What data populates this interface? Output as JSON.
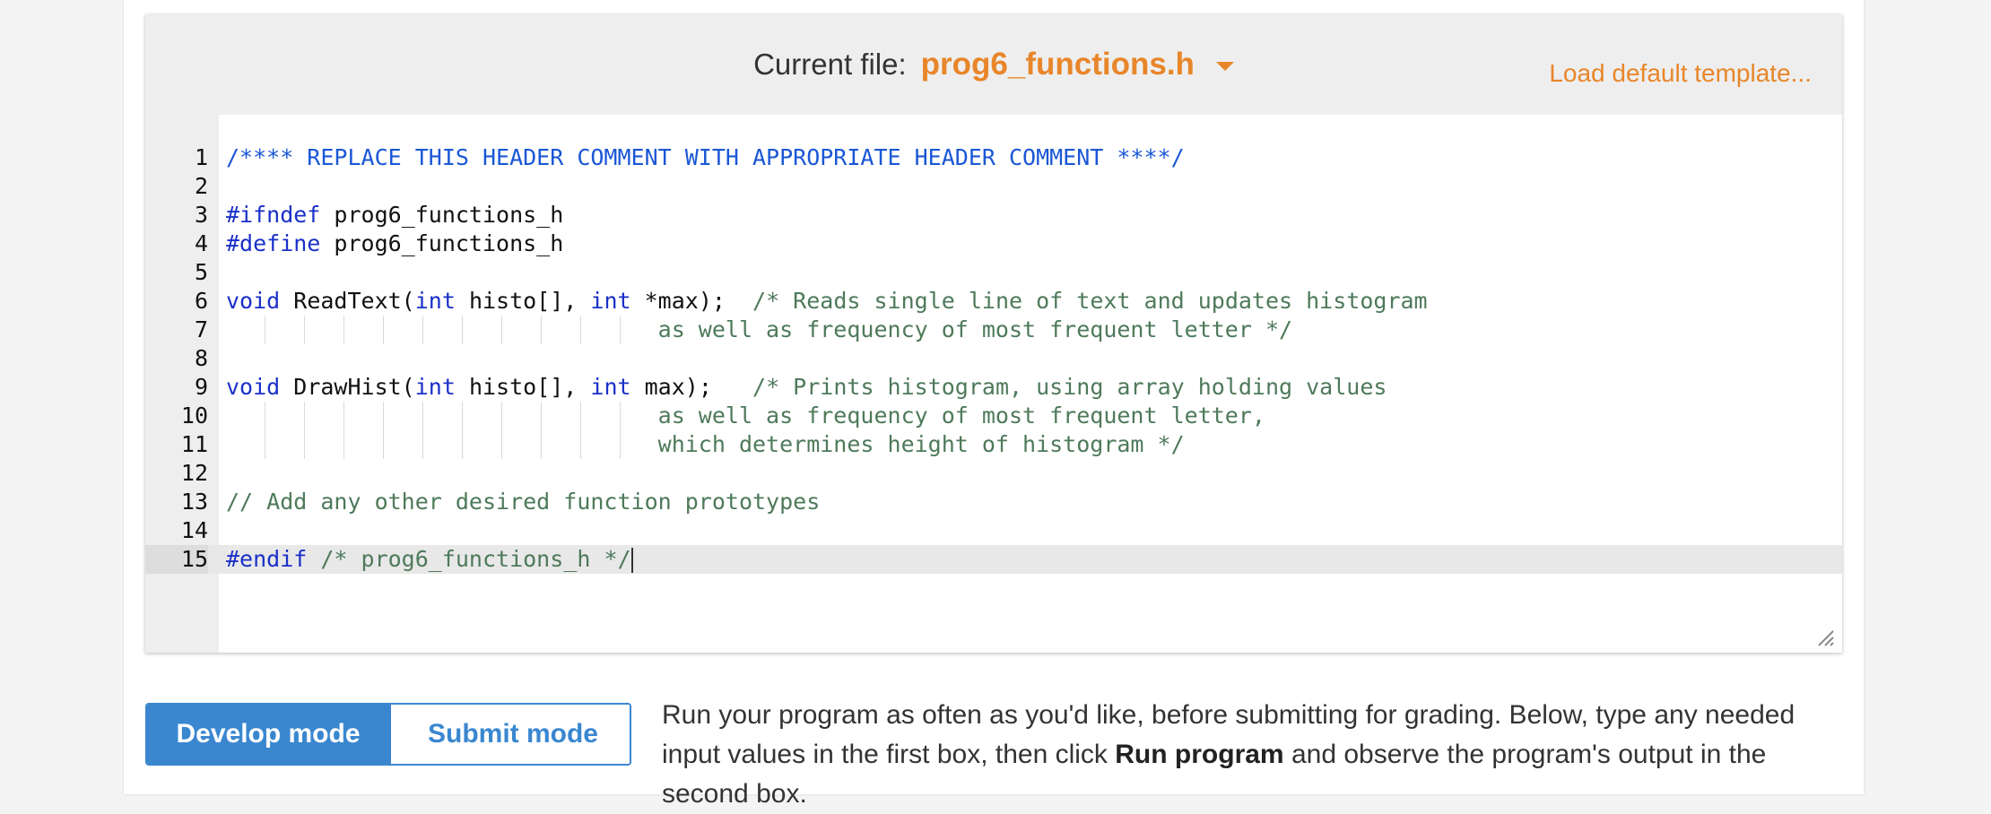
{
  "header": {
    "current_file_label": "Current file:",
    "current_file_name": "prog6_functions.h",
    "load_default_label": "Load default template..."
  },
  "editor": {
    "lines": [
      {
        "n": "1",
        "tokens": [
          {
            "t": "/**** REPLACE THIS HEADER COMMENT WITH APPROPRIATE HEADER COMMENT ****/",
            "c": "comment-blue"
          }
        ]
      },
      {
        "n": "2",
        "tokens": []
      },
      {
        "n": "3",
        "tokens": [
          {
            "t": "#ifndef",
            "c": "pre"
          },
          {
            "t": " prog6_functions_h",
            "c": ""
          }
        ]
      },
      {
        "n": "4",
        "tokens": [
          {
            "t": "#define",
            "c": "pre"
          },
          {
            "t": " prog6_functions_h",
            "c": ""
          }
        ]
      },
      {
        "n": "5",
        "tokens": []
      },
      {
        "n": "6",
        "tokens": [
          {
            "t": "void",
            "c": "kw"
          },
          {
            "t": " ReadText(",
            "c": ""
          },
          {
            "t": "int",
            "c": "kw"
          },
          {
            "t": " histo[], ",
            "c": ""
          },
          {
            "t": "int",
            "c": "kw"
          },
          {
            "t": " *max);  ",
            "c": ""
          },
          {
            "t": "/* Reads single line of text and updates histogram",
            "c": "comment"
          }
        ]
      },
      {
        "n": "7",
        "guides": true,
        "tokens": [
          {
            "t": "                                ",
            "c": ""
          },
          {
            "t": "as well as frequency of most frequent letter */",
            "c": "comment"
          }
        ]
      },
      {
        "n": "8",
        "tokens": []
      },
      {
        "n": "9",
        "tokens": [
          {
            "t": "void",
            "c": "kw"
          },
          {
            "t": " DrawHist(",
            "c": ""
          },
          {
            "t": "int",
            "c": "kw"
          },
          {
            "t": " histo[], ",
            "c": ""
          },
          {
            "t": "int",
            "c": "kw"
          },
          {
            "t": " max);   ",
            "c": ""
          },
          {
            "t": "/* Prints histogram, using array holding values",
            "c": "comment"
          }
        ]
      },
      {
        "n": "10",
        "guides": true,
        "tokens": [
          {
            "t": "                                ",
            "c": ""
          },
          {
            "t": "as well as frequency of most frequent letter,",
            "c": "comment"
          }
        ]
      },
      {
        "n": "11",
        "guides": true,
        "tokens": [
          {
            "t": "                                ",
            "c": ""
          },
          {
            "t": "which determines height of histogram */",
            "c": "comment"
          }
        ]
      },
      {
        "n": "12",
        "tokens": []
      },
      {
        "n": "13",
        "tokens": [
          {
            "t": "// Add any other desired function prototypes",
            "c": "comment"
          }
        ]
      },
      {
        "n": "14",
        "tokens": []
      },
      {
        "n": "15",
        "active": true,
        "cursor": true,
        "tokens": [
          {
            "t": "#endif",
            "c": "pre"
          },
          {
            "t": " /* prog6_functions_h */",
            "c": "comment"
          }
        ]
      }
    ]
  },
  "modes": {
    "develop_label": "Develop mode",
    "submit_label": "Submit mode",
    "active": "develop"
  },
  "instructions": {
    "part1": "Run your program as often as you'd like, before submitting for grading. Below, type any needed input values in the first box, then click ",
    "bold": "Run program",
    "part2": " and observe the program's output in the second box."
  },
  "colors": {
    "accent_orange": "#e8862a",
    "accent_blue": "#3a87d0"
  }
}
